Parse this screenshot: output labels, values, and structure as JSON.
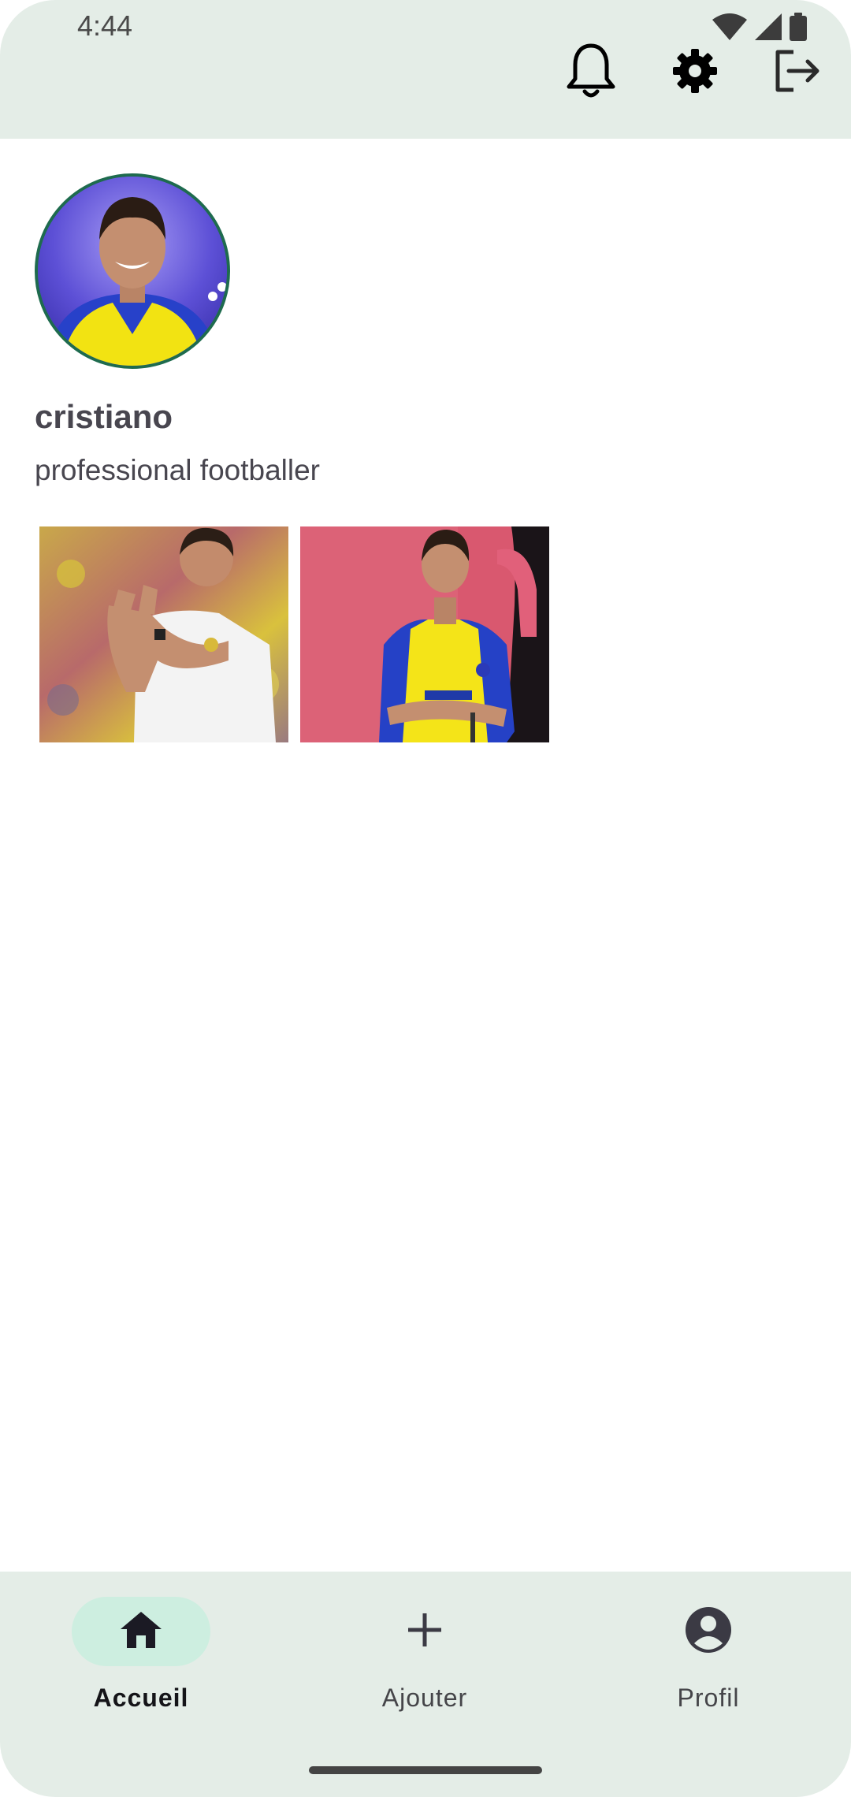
{
  "status_bar": {
    "time": "4:44",
    "icons": [
      "wifi-icon",
      "signal-icon",
      "battery-icon"
    ]
  },
  "top_bar": {
    "actions": [
      "bell-icon",
      "gear-icon",
      "logout-icon"
    ]
  },
  "profile": {
    "username": "cristiano",
    "bio": "professional footballer"
  },
  "posts": [
    {
      "name": "post-photo-white-shirt-applauding"
    },
    {
      "name": "post-photo-yellow-jersey-arms-crossed"
    }
  ],
  "bottom_nav": {
    "items": [
      {
        "label": "Accueil",
        "icon": "home-icon",
        "active": true
      },
      {
        "label": "Ajouter",
        "icon": "plus-icon",
        "active": false
      },
      {
        "label": "Profil",
        "icon": "account-circle-icon",
        "active": false
      }
    ]
  },
  "colors": {
    "bar_background": "#e4ede7",
    "active_pill": "#cdeee0",
    "avatar_border": "#1e6b4e",
    "text": "#48464f"
  }
}
